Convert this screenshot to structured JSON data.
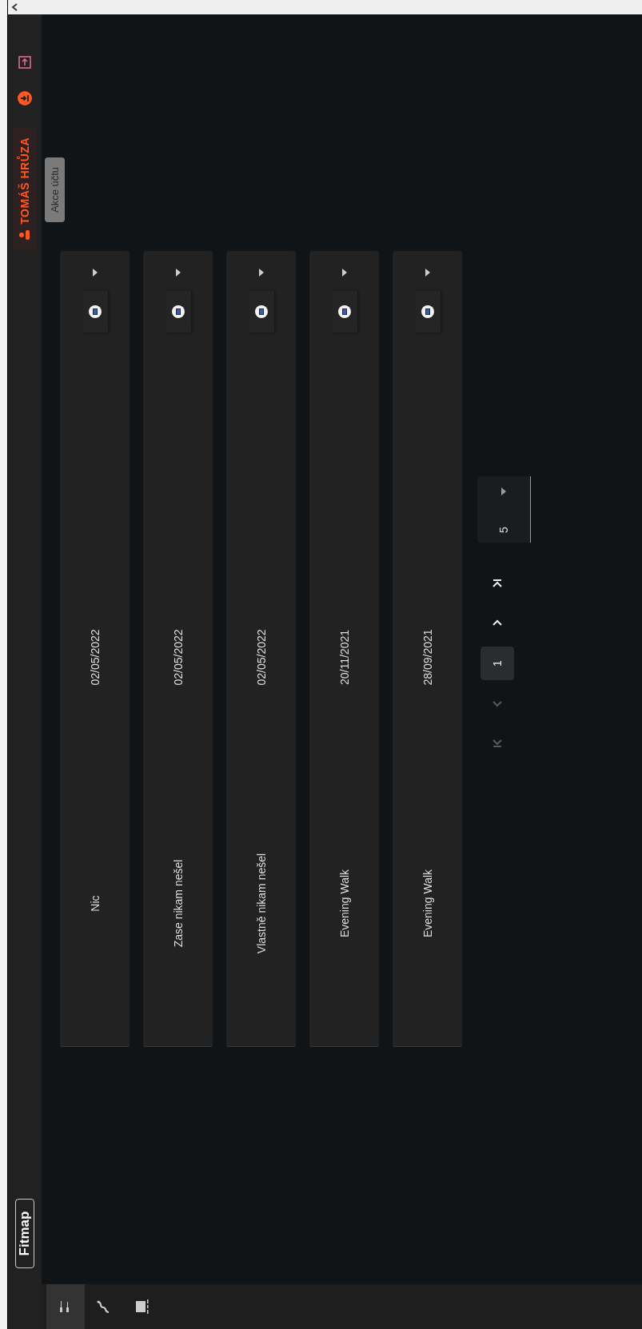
{
  "app_bar": {
    "logo": "Fitmap",
    "account": {
      "name": "TOMÁŠ HRŮZA"
    },
    "tooltip": "Akce účtu"
  },
  "sidebar": {
    "items": [
      {
        "selected": true
      },
      {
        "selected": false
      },
      {
        "selected": false
      }
    ]
  },
  "activities": [
    {
      "name": "Nic",
      "date": "02/05/2022"
    },
    {
      "name": "Zase nikam nešel",
      "date": "02/05/2022"
    },
    {
      "name": "Vlastně nikam nešel",
      "date": "02/05/2022"
    },
    {
      "name": "Evening Walk",
      "date": "20/11/2021"
    },
    {
      "name": "Evening Walk",
      "date": "28/09/2021"
    }
  ],
  "pagination": {
    "first": {
      "disabled": true
    },
    "prev": {
      "disabled": true
    },
    "pages": [
      {
        "label": "1",
        "selected": true
      }
    ],
    "next": {
      "disabled": false
    },
    "last": {
      "disabled": false
    },
    "page_size": "5"
  }
}
